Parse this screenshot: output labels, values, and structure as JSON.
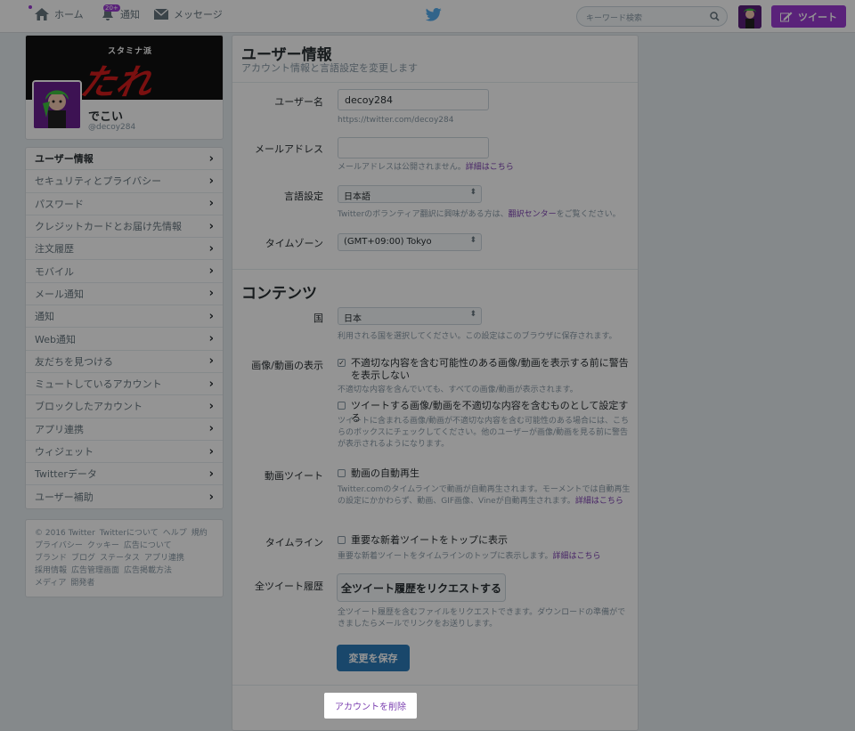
{
  "topbar": {
    "home": "ホーム",
    "notifications_badge": "20+",
    "notifications": "通知",
    "messages": "メッセージ",
    "search_placeholder": "キーワード検索",
    "tweet_button": "ツイート"
  },
  "profile": {
    "banner_sub": "スタミナ派",
    "banner_title": "たれ",
    "name": "でこい",
    "handle": "@decoy284"
  },
  "menu": [
    {
      "label": "ユーザー情報",
      "active": true
    },
    {
      "label": "セキュリティとプライバシー"
    },
    {
      "label": "パスワード"
    },
    {
      "label": "クレジットカードとお届け先情報"
    },
    {
      "label": "注文履歴"
    },
    {
      "label": "モバイル"
    },
    {
      "label": "メール通知"
    },
    {
      "label": "通知"
    },
    {
      "label": "Web通知"
    },
    {
      "label": "友だちを見つける"
    },
    {
      "label": "ミュートしているアカウント"
    },
    {
      "label": "ブロックしたアカウント"
    },
    {
      "label": "アプリ連携"
    },
    {
      "label": "ウィジェット"
    },
    {
      "label": "Twitterデータ"
    },
    {
      "label": "ユーザー補助"
    }
  ],
  "footer": {
    "line1": [
      "© 2016 Twitter",
      "Twitterについて",
      "ヘルプ",
      "規約"
    ],
    "line2": [
      "プライバシー",
      "クッキー",
      "広告について"
    ],
    "line3": [
      "ブランド",
      "ブログ",
      "ステータス",
      "アプリ連携"
    ],
    "line4": [
      "採用情報",
      "広告管理画面",
      "広告掲載方法"
    ],
    "line5": [
      "メディア",
      "開発者"
    ]
  },
  "main": {
    "title": "ユーザー情報",
    "subtitle": "アカウント情報と言語設定を変更します",
    "username_label": "ユーザー名",
    "username_value": "decoy284",
    "username_url": "https://twitter.com/decoy284",
    "email_label": "メールアドレス",
    "email_value": "",
    "email_note": "メールアドレスは公開されません。",
    "email_note_link": "詳細はこちら",
    "language_label": "言語設定",
    "language_value": "日本語",
    "language_note": "Twitterのボランティア翻訳に興味がある方は、",
    "language_note_link": "翻訳センター",
    "language_note_tail": "をご覧ください。",
    "timezone_label": "タイムゾーン",
    "timezone_value": "(GMT+09:00) Tokyo",
    "content_title": "コンテンツ",
    "country_label": "国",
    "country_value": "日本",
    "country_note": "利用される国を選択してください。この設定はこのブラウザに保存されます。",
    "media_label": "画像/動画の表示",
    "media_check1": "不適切な内容を含む可能性のある画像/動画を表示する前に警告を表示しない",
    "media_check1_note": "不適切な内容を含んでいても、すべての画像/動画が表示されます。",
    "media_check2": "ツイートする画像/動画を不適切な内容を含むものとして設定する",
    "media_check2_note": "ツイートに含まれる画像/動画が不適切な内容を含む可能性のある場合には、こちらのボックスにチェックしてください。他のユーザーが画像/動画を見る前に警告が表示されるようになります。",
    "video_label": "動画ツイート",
    "video_check": "動画の自動再生",
    "video_note": "Twitter.comのタイムラインで動画が自動再生されます。モーメントでは自動再生の設定にかかわらず、動画、GIF画像、Vineが自動再生されます。",
    "video_note_link": "詳細はこちら",
    "timeline_label": "タイムライン",
    "timeline_check": "重要な新着ツイートをトップに表示",
    "timeline_note": "重要な新着ツイートをタイムラインのトップに表示します。",
    "timeline_note_link": "詳細はこちら",
    "archive_label": "全ツイート履歴",
    "archive_button": "全ツイート履歴をリクエストする",
    "archive_note": "全ツイート履歴を含むファイルをリクエストできます。ダウンロードの準備ができましたらメールでリンクをお送りします。",
    "save_button": "変更を保存",
    "delete_link": "アカウントを削除"
  },
  "colors": {
    "accent": "#9b3bd3",
    "save": "#2b7bb9",
    "link": "#7b3fb0"
  }
}
